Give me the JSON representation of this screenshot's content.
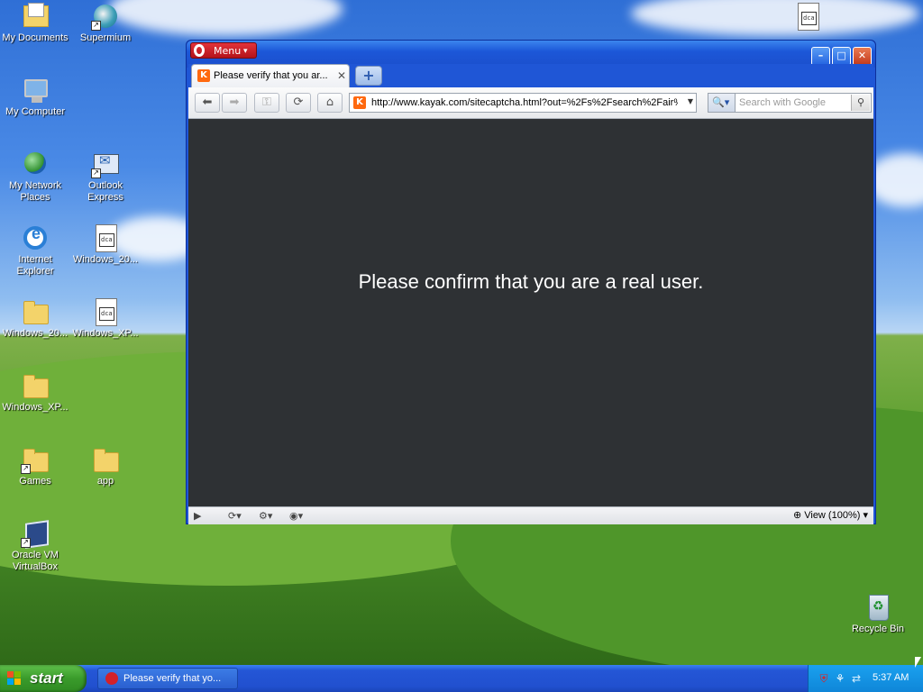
{
  "desktop": {
    "icons": {
      "my_documents": "My Documents",
      "supermium": "Supermium",
      "my_computer": "My Computer",
      "my_network_places": "My Network Places",
      "outlook_express": "Outlook Express",
      "internet_explorer": "Internet Explorer",
      "windows_20_a": "Windows_20...",
      "windows_20_b": "Windows_20...",
      "windows_xp_a": "Windows_XP...",
      "windows_xp_b": "Windows_XP...",
      "games": "Games",
      "app": "app",
      "virtualbox": "Oracle VM VirtualBox",
      "recycle_bin": "Recycle Bin"
    }
  },
  "browser": {
    "menu_label": "Menu",
    "tab_title": "Please verify that you ar...",
    "address_url": "http://www.kayak.com/sitecaptcha.html?out=%2Fs%2Fsearch%2Fair%",
    "search_placeholder": "Search with Google",
    "page_message": "Please confirm that you are a real user.",
    "zoom_label": "View (100%)"
  },
  "taskbar": {
    "start_label": "start",
    "task_label": "Please verify that yo...",
    "clock": "5:37 AM"
  },
  "colors": {
    "content_bg": "#2e3134",
    "kayak_orange": "#ff690f",
    "opera_red": "#d3212a"
  }
}
